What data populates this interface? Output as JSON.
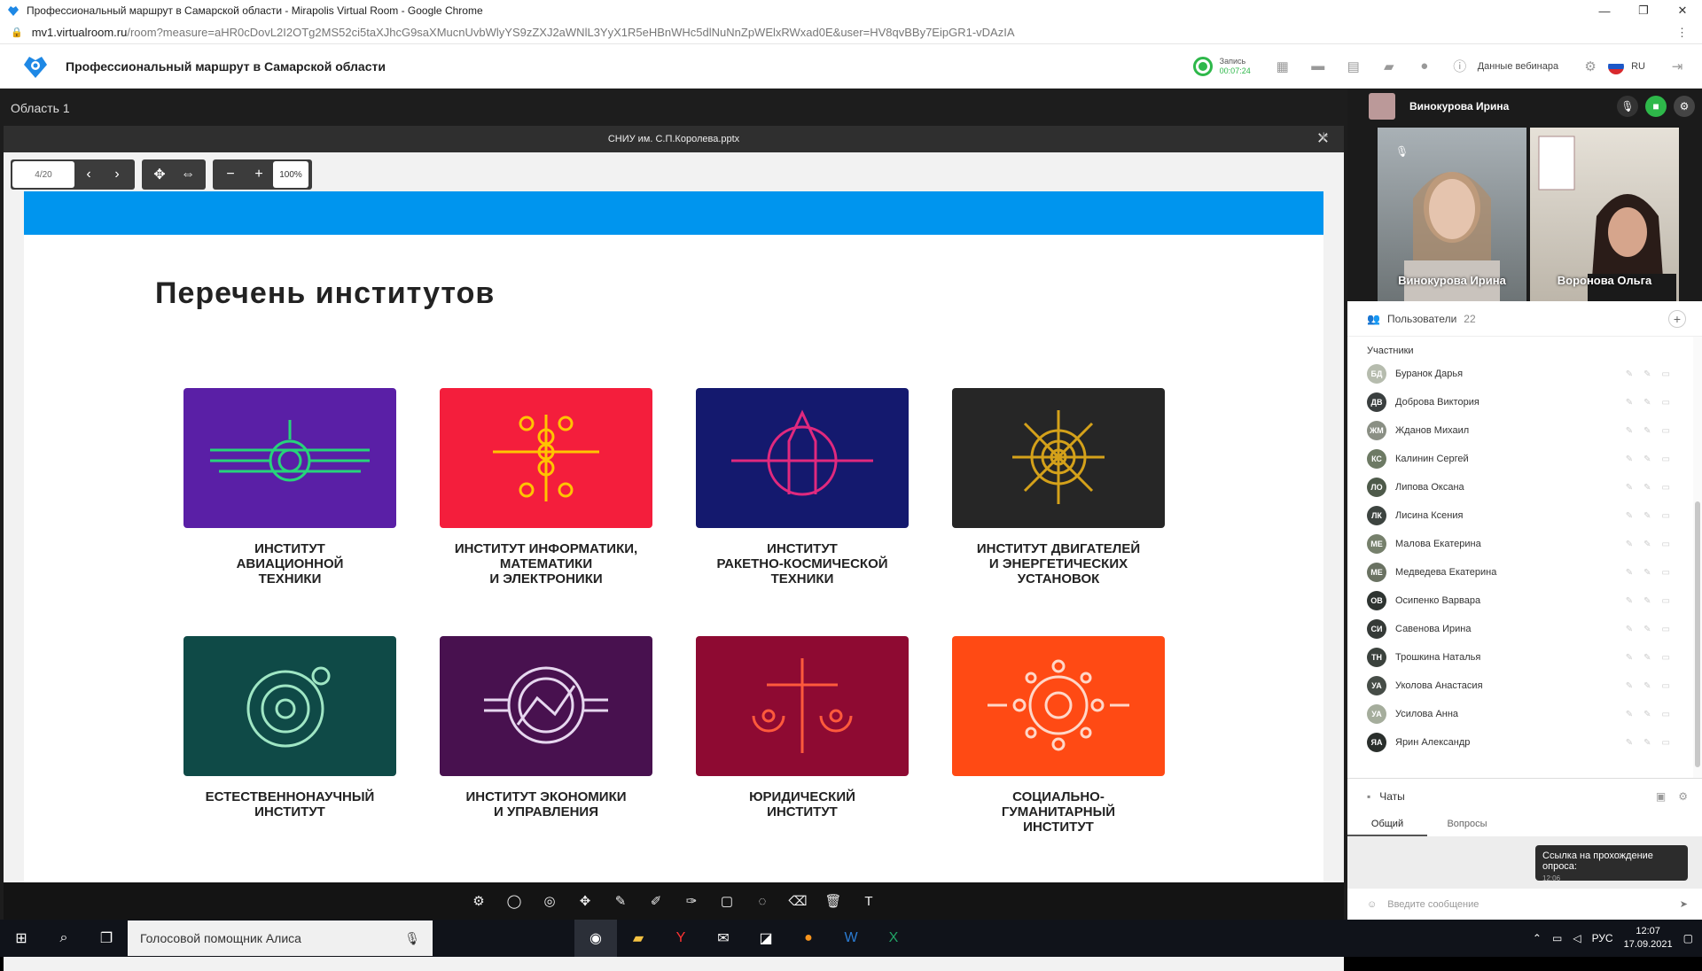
{
  "browser": {
    "title": "Профессиональный маршрут в Самарской области - Mirapolis Virtual Room - Google Chrome",
    "url_host": "mv1.virtualroom.ru",
    "url_path": "/room?measure=aHR0cDovL2I2OTg2MS52ci5taXJhcG9saXMucnUvbWlyYS9zZXJ2aWNlL3YyX1R5eHBnWHc5dlNuNnZpWElxRWxad0E&user=HV8qvBBy7EipGR1-vDAzIA"
  },
  "app": {
    "title": "Профессиональный маршрут в Самарской области",
    "record_label": "Запись",
    "record_time": "00:07:24",
    "webinar_data_label": "Данные вебинара",
    "language": "RU"
  },
  "area": {
    "label": "Область 1",
    "doc_name": "СНИУ им. С.П.Королева.pptx",
    "page": "4/20",
    "zoom": "100%"
  },
  "slide": {
    "heading": "Перечень институтов",
    "cards": [
      {
        "label": "ИНСТИТУТ\nАВИАЦИОННОЙ\nТЕХНИКИ",
        "color": "#5a1fa6"
      },
      {
        "label": "ИНСТИТУТ ИНФОРМАТИКИ,\nМАТЕМАТИКИ\nИ ЭЛЕКТРОНИКИ",
        "color": "#f41e3c"
      },
      {
        "label": "ИНСТИТУТ\nРАКЕТНО-КОСМИЧЕСКОЙ\nТЕХНИКИ",
        "color": "#14196e"
      },
      {
        "label": "ИНСТИТУТ ДВИГАТЕЛЕЙ\nИ ЭНЕРГЕТИЧЕСКИХ\nУСТАНОВОК",
        "color": "#262626"
      },
      {
        "label": "ЕСТЕСТВЕННОНАУЧНЫЙ\nИНСТИТУТ",
        "color": "#0f4a47"
      },
      {
        "label": "ИНСТИТУТ ЭКОНОМИКИ\nИ УПРАВЛЕНИЯ",
        "color": "#48114f"
      },
      {
        "label": "ЮРИДИЧЕСКИЙ\nИНСТИТУТ",
        "color": "#8e0a32"
      },
      {
        "label": "СОЦИАЛЬНО-\nГУМАНИТАРНЫЙ\nИНСТИТУТ",
        "color": "#ff4a14"
      }
    ]
  },
  "video": {
    "speaker": "Винокурова Ирина",
    "tiles": [
      "Винокурова Ирина",
      "Воронова Ольга"
    ]
  },
  "users": {
    "title": "Пользователи",
    "count": "22",
    "group": "Участники",
    "list": [
      {
        "initials": "БД",
        "name": "Буранок Дарья",
        "color": "#b6bcae"
      },
      {
        "initials": "ДВ",
        "name": "Доброва Виктория",
        "color": "#3a3f3f"
      },
      {
        "initials": "ЖМ",
        "name": "Жданов Михаил",
        "color": "#8a8f84"
      },
      {
        "initials": "КС",
        "name": "Калинин Сергей",
        "color": "#6d7a64"
      },
      {
        "initials": "ЛО",
        "name": "Липова Оксана",
        "color": "#4e5a4a"
      },
      {
        "initials": "ЛК",
        "name": "Лисина Ксения",
        "color": "#3d4440"
      },
      {
        "initials": "МЕ",
        "name": "Малова Екатерина",
        "color": "#76806c"
      },
      {
        "initials": "МЕ",
        "name": "Медведева Екатерина",
        "color": "#6a7262"
      },
      {
        "initials": "ОВ",
        "name": "Осипенко Варвара",
        "color": "#2e3431"
      },
      {
        "initials": "СИ",
        "name": "Савенова Ирина",
        "color": "#353a37"
      },
      {
        "initials": "ТН",
        "name": "Трошкина Наталья",
        "color": "#3b423d"
      },
      {
        "initials": "УА",
        "name": "Уколова Анастасия",
        "color": "#464d47"
      },
      {
        "initials": "УА",
        "name": "Усилова Анна",
        "color": "#a5ad9c"
      },
      {
        "initials": "ЯА",
        "name": "Ярин Александр",
        "color": "#2a2f2c"
      }
    ]
  },
  "chat": {
    "title": "Чаты",
    "tabs": [
      "Общий",
      "Вопросы"
    ],
    "message": "Ссылка на прохождение опроса:",
    "message_time": "12:06",
    "input_placeholder": "Введите сообщение"
  },
  "taskbar": {
    "search_text": "Голосовой помощник Алиса",
    "lang": "РУС",
    "time": "12:07",
    "date": "17.09.2021"
  }
}
